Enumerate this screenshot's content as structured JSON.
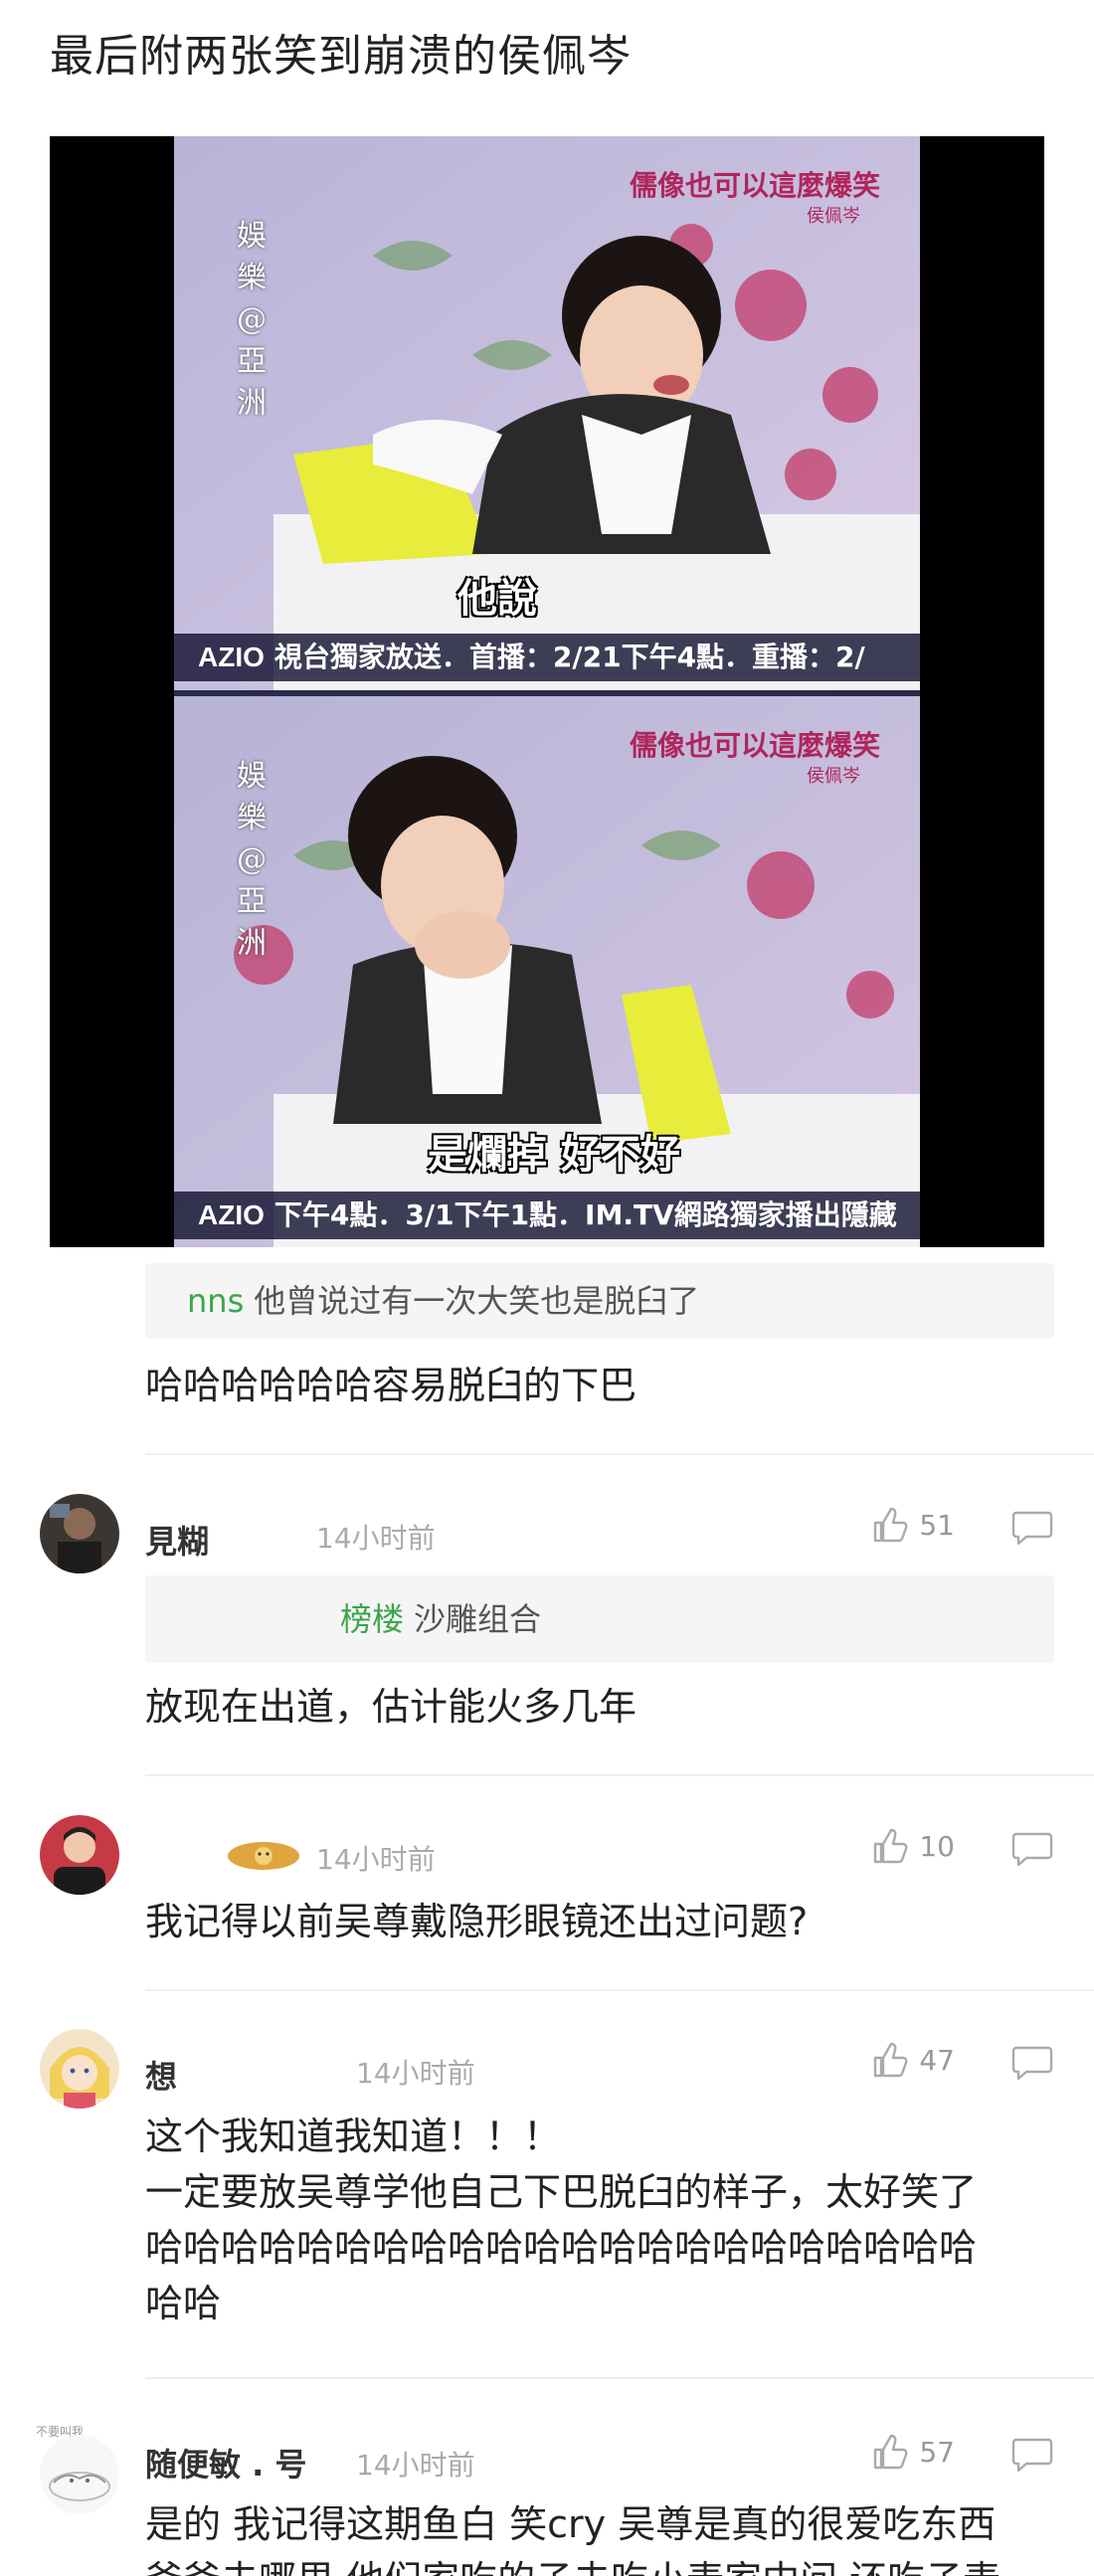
{
  "post": {
    "text": "最后附两张笑到崩溃的侯佩岑"
  },
  "media": {
    "top_frame": {
      "title_mark": "儒像也可以這麼爆笑",
      "title_sub": "侯佩岑",
      "side_mark": [
        "娛",
        "樂",
        "@",
        "亞",
        "洲"
      ],
      "subtitle": "他說",
      "ticker_brand": "AZIO",
      "ticker_text": "視台獨家放送．首播：2/21下午4點．重播：2/"
    },
    "bottom_frame": {
      "title_mark": "儒像也可以這麼爆笑",
      "title_sub": "侯佩岑",
      "side_mark": [
        "娛",
        "樂",
        "@",
        "亞",
        "洲"
      ],
      "subtitle": "是爛掉 好不好",
      "ticker_brand": "AZIO",
      "ticker_text": "下午4點．3/1下午1點．IM.TV網路獨家播出隱藏"
    }
  },
  "comments": [
    {
      "quote_name": "nns",
      "quote_text": "他曾说过有一次大笑也是脱臼了",
      "text": "哈哈哈哈哈哈容易脱臼的下巴"
    },
    {
      "username": "見糊",
      "time": "14小时前",
      "likes": "51",
      "quote_name": "榜楼",
      "quote_text": "沙雕组合",
      "text": "放现在出道，估计能火多几年",
      "avatar_icon": "avatar-dark-icon"
    },
    {
      "username": "",
      "time": "14小时前",
      "likes": "10",
      "text": "我记得以前吴尊戴隐形眼镜还出过问题?",
      "avatar_icon": "avatar-man-icon"
    },
    {
      "username": "想",
      "time": "14小时前",
      "likes": "47",
      "lines": [
        "这个我知道我知道！！！",
        "一定要放吴尊学他自己下巴脱臼的样子，太好笑了",
        "哈哈哈哈哈哈哈哈哈哈哈哈哈哈哈哈哈哈哈哈哈哈",
        "哈哈"
      ],
      "avatar_icon": "avatar-cartoon-icon"
    },
    {
      "username": "随便敏 . 号",
      "time": "14小时前",
      "likes": "57",
      "badge": "不要叫我",
      "text": "是的 我记得这期鱼白 笑cry 吴尊是真的很爱吃东西",
      "text2": "爸爸去哪里 他们家吃的子去吃小麦家中问 还吃子麦",
      "avatar_icon": "avatar-sketch-icon"
    }
  ],
  "colors": {
    "quote_name": "#3aa64a",
    "time": "#aaaaaa",
    "divider": "#eeeeee"
  }
}
